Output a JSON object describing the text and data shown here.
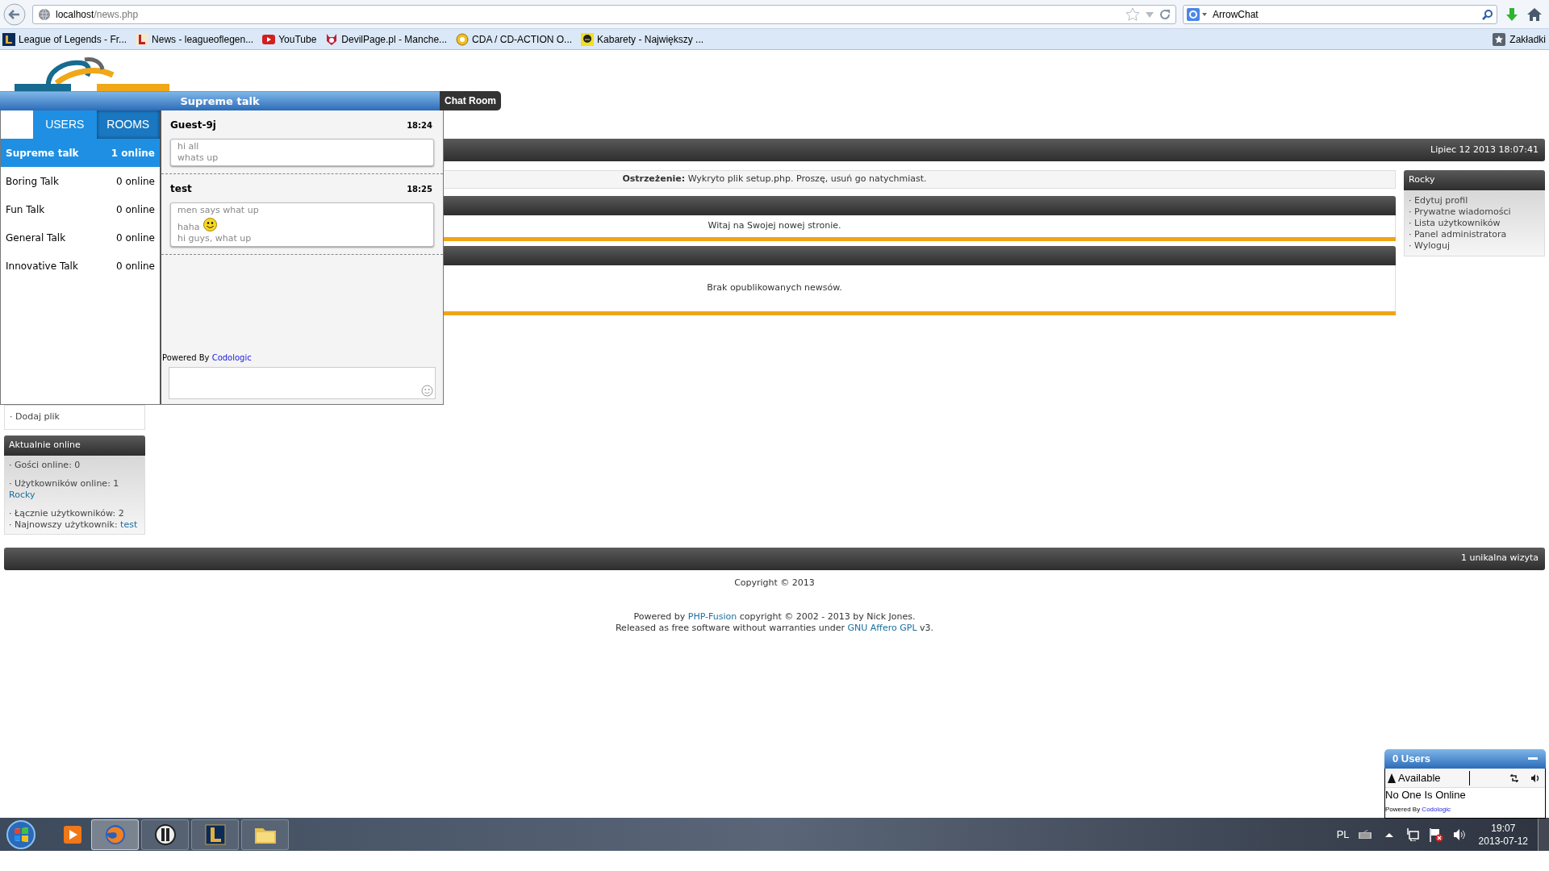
{
  "browser": {
    "url_host": "localhost",
    "url_path": "/news.php",
    "search_value": "ArrowChat"
  },
  "bookmarks": [
    {
      "kind": "lol",
      "label": "League of Legends - Fr..."
    },
    {
      "kind": "news",
      "label": "News - leagueoflegen..."
    },
    {
      "kind": "youtube",
      "label": "YouTube"
    },
    {
      "kind": "devil",
      "label": "DevilPage.pl - Manche..."
    },
    {
      "kind": "cda",
      "label": "CDA / CD-ACTION O..."
    },
    {
      "kind": "kabarety",
      "label": "Kabarety - Największy ..."
    }
  ],
  "bookmarks_menu": "Zakładki",
  "site": {
    "header_date": "Lipiec 12 2013 18:07:41",
    "warning": "**Ostrzeżenie:** Wykryto plik setup.php. Proszę, usuń go natychmiast.",
    "panels": [
      {
        "text": "Witaj na Swojej nowej stronie."
      },
      {
        "text": "Brak opublikowanych newsów."
      }
    ],
    "left_links": [
      "· Dodaj plik"
    ],
    "online": {
      "title": "Aktualnie online",
      "groups": [
        [
          {
            "text": "· Gości online: 0"
          }
        ],
        [
          {
            "text": "· Użytkowników online: 1"
          },
          {
            "link": "Rocky"
          }
        ],
        [
          {
            "text": "· Łącznie użytkowników: 2"
          },
          {
            "text": "· Najnowszy użytkownik:",
            "link": "test"
          }
        ]
      ]
    },
    "user_panel": {
      "title": "Rocky",
      "links": [
        "· Edytuj profil",
        "· Prywatne wiadomości",
        "· Lista użytkowników",
        "· Panel administratora",
        "· Wyloguj"
      ]
    },
    "footer_visits": "1 unikalna wizyta",
    "copyright": "Copyright © 2013",
    "credits": [
      [
        {
          "kind": "text",
          "text": "Powered by "
        },
        {
          "kind": "link",
          "text": "PHP-Fusion"
        },
        {
          "kind": "text",
          "text": " copyright © 2002 - 2013 by Nick Jones."
        }
      ],
      [
        {
          "kind": "text",
          "text": "Released as free software without warranties under "
        },
        {
          "kind": "link",
          "text": "GNU Affero GPL"
        },
        {
          "kind": "text",
          "text": " v3."
        }
      ]
    ]
  },
  "chat": {
    "title": "Supreme talk",
    "tab_label": "Chat Room",
    "tabs": [
      {
        "label": "USERS",
        "selected": false
      },
      {
        "label": "ROOMS",
        "selected": true
      }
    ],
    "rooms": [
      {
        "name": "Supreme talk",
        "count": "1 online",
        "selected": true
      },
      {
        "name": "Boring Talk",
        "count": "0 online",
        "selected": false
      },
      {
        "name": "Fun Talk",
        "count": "0 online",
        "selected": false
      },
      {
        "name": "General Talk",
        "count": "0 online",
        "selected": false
      },
      {
        "name": "Innovative Talk",
        "count": "0 online",
        "selected": false
      }
    ],
    "messages": [
      {
        "sender": "Guest-9j",
        "time": "18:24",
        "lines": [
          {
            "text": "hi all",
            "emoji": false
          },
          {
            "text": "whats up",
            "emoji": false
          }
        ]
      },
      {
        "sender": "test",
        "time": "18:25",
        "lines": [
          {
            "text": "men says what up",
            "emoji": false
          },
          {
            "text": "haha",
            "emoji": true
          },
          {
            "text": "hi guys, what up",
            "emoji": false
          }
        ]
      }
    ],
    "powered_by": "Powered By",
    "powered_link": "Codologic"
  },
  "buddy": {
    "title": "0 Users",
    "status": "Available",
    "empty": "No One Is Online",
    "powered_by": "Powered By",
    "powered_link": "Codologic"
  },
  "taskbar": {
    "apps": [
      {
        "kind": "media",
        "selected": false
      },
      {
        "kind": "firefox",
        "selected": true
      },
      {
        "kind": "client",
        "selected": false
      },
      {
        "kind": "game",
        "selected": false
      },
      {
        "kind": "folder",
        "selected": false
      }
    ],
    "lang": "PL",
    "time": "19:07",
    "date": "2013-07-12"
  }
}
